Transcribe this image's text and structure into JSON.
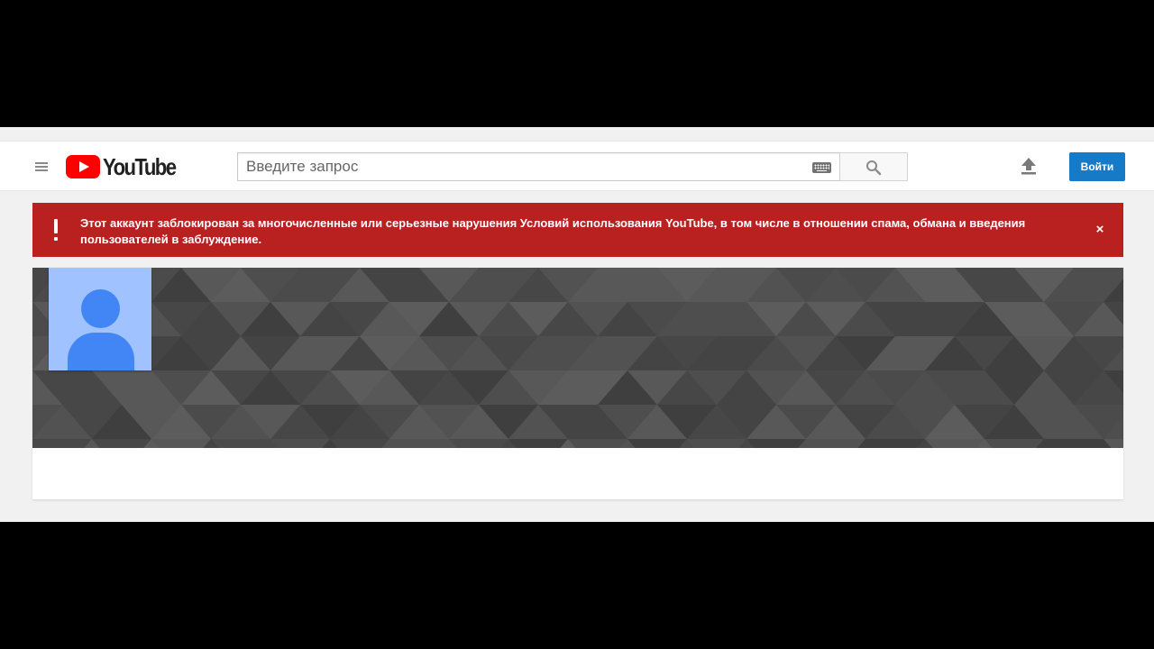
{
  "app": {
    "name": "YouTube",
    "brand_color": "#ff0000"
  },
  "header": {
    "logo_text": "YouTube",
    "search": {
      "placeholder": "Введите запрос",
      "value": ""
    },
    "signin_label": "Войти",
    "signin_color": "#167ac6",
    "icons": {
      "menu": "hamburger-menu-icon",
      "keyboard": "keyboard-icon",
      "search": "search-icon",
      "upload": "upload-icon"
    }
  },
  "alert": {
    "message": "Этот аккаунт заблокирован за многочисленные или серьезные нарушения Условий использования YouTube, в том числе в отношении спама, обмана и введения пользователей в заблуждение.",
    "close_glyph": "×",
    "background_color": "#b82120",
    "icon": "exclamation-icon"
  },
  "channel": {
    "avatar_icon": "default-avatar-icon",
    "banner": "gray-triangle-pattern"
  }
}
